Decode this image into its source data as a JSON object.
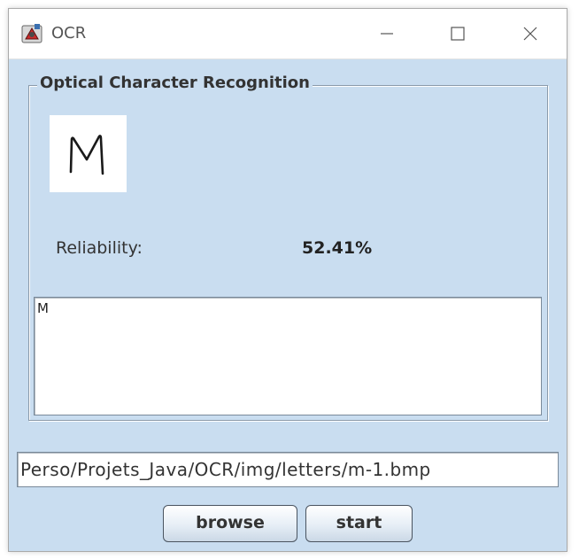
{
  "window": {
    "title": "OCR",
    "icon": "java-app-icon",
    "controls": [
      "minimize-icon",
      "maximize-icon",
      "close-icon"
    ]
  },
  "panel": {
    "legend": "Optical Character Recognition",
    "preview_glyph": "M",
    "reliability_label": "Reliability:",
    "reliability_value": "52.41%",
    "output_text": "M"
  },
  "path_field": {
    "value": "Perso/Projets_Java/OCR/img/letters/m-1.bmp"
  },
  "buttons": {
    "browse_label": "browse",
    "start_label": "start"
  },
  "colors": {
    "window_background": "#c9ddf0",
    "titlebar_background": "#ffffff",
    "text": "#333333"
  }
}
